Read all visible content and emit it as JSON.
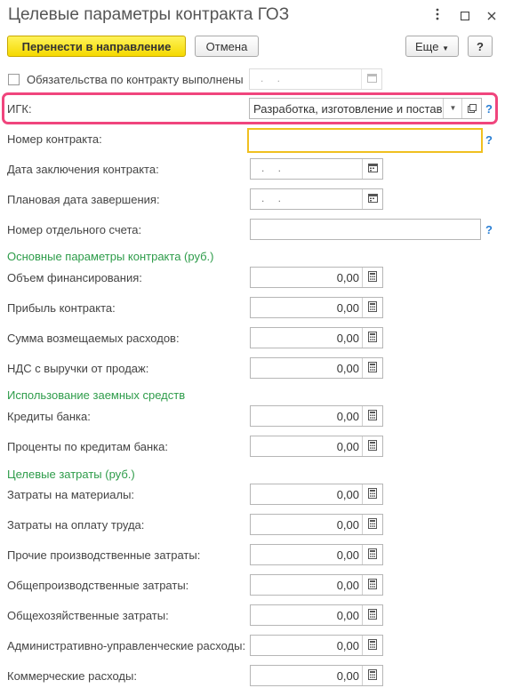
{
  "window": {
    "title": "Целевые параметры контракта ГОЗ",
    "menu_icon": "kebab-icon",
    "maximize_icon": "square-icon",
    "close_icon": "close-icon"
  },
  "toolbar": {
    "transfer_label": "Перенести в направление",
    "cancel_label": "Отмена",
    "more_label": "Еще",
    "help_label": "?"
  },
  "fields": {
    "obligations_label": "Обязательства по контракту выполнены",
    "obligations_date": ". .",
    "igk_label": "ИГК:",
    "igk_value": "Разработка, изготовление и постав",
    "contract_number_label": "Номер контракта:",
    "contract_number_value": "",
    "conclusion_date_label": "Дата заключения контракта:",
    "conclusion_date_value": ". .",
    "planned_end_label": "Плановая дата завершения:",
    "planned_end_value": ". .",
    "account_label": "Номер отдельного счета:",
    "account_value": ""
  },
  "sections": {
    "main_params": "Основные параметры контракта (руб.)",
    "borrowed": "Использование заемных средств",
    "target_costs": "Целевые затраты (руб.)"
  },
  "money": {
    "funding": {
      "label": "Объем финансирования:",
      "value": "0,00"
    },
    "profit": {
      "label": "Прибыль контракта:",
      "value": "0,00"
    },
    "reimbursed": {
      "label": "Сумма возмещаемых расходов:",
      "value": "0,00"
    },
    "vat": {
      "label": "НДС с выручки от продаж:",
      "value": "0,00"
    },
    "bank_credits": {
      "label": "Кредиты банка:",
      "value": "0,00"
    },
    "credit_interest": {
      "label": "Проценты по кредитам банка:",
      "value": "0,00"
    },
    "materials": {
      "label": "Затраты на материалы:",
      "value": "0,00"
    },
    "labor": {
      "label": "Затраты на оплату труда:",
      "value": "0,00"
    },
    "other_production": {
      "label": "Прочие производственные затраты:",
      "value": "0,00"
    },
    "general_production": {
      "label": "Общепроизводственные затраты:",
      "value": "0,00"
    },
    "general_business": {
      "label": "Общехозяйственные затраты:",
      "value": "0,00"
    },
    "admin": {
      "label": "Административно-управленческие расходы:",
      "value": "0,00"
    },
    "commercial": {
      "label": "Коммерческие расходы:",
      "value": "0,00"
    }
  },
  "help_mark": "?",
  "colors": {
    "accent": "#f5d900",
    "section": "#2e9c4a",
    "highlight": "#f0457d",
    "help": "#2a7fd4",
    "focus": "#f0c020"
  }
}
